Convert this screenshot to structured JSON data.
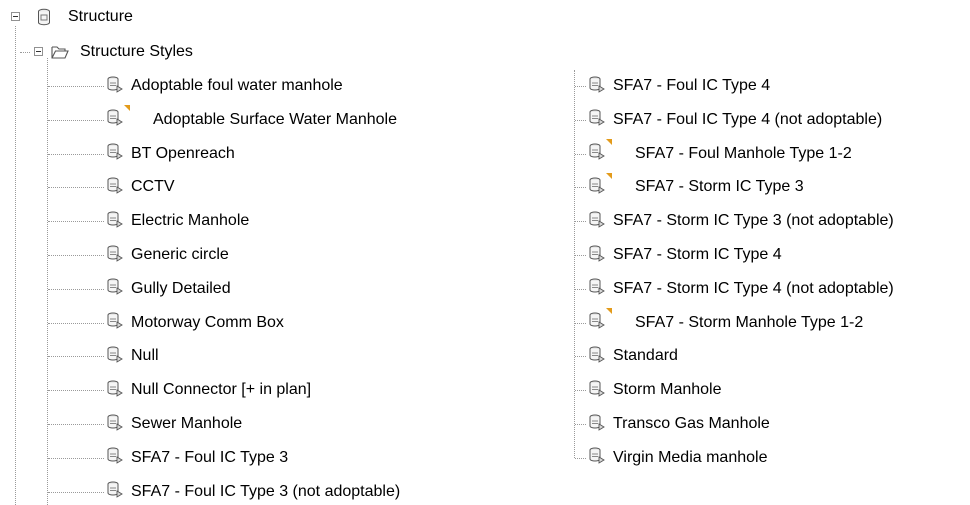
{
  "tree": {
    "root_label": "Structure",
    "styles_label": "Structure Styles",
    "left_items": [
      {
        "label": "Adoptable foul water manhole",
        "flag": false
      },
      {
        "label": "Adoptable Surface Water Manhole",
        "flag": true
      },
      {
        "label": "BT Openreach",
        "flag": false
      },
      {
        "label": "CCTV",
        "flag": false
      },
      {
        "label": "Electric Manhole",
        "flag": false
      },
      {
        "label": "Generic circle",
        "flag": false
      },
      {
        "label": "Gully Detailed",
        "flag": false
      },
      {
        "label": "Motorway Comm Box",
        "flag": false
      },
      {
        "label": "Null",
        "flag": false
      },
      {
        "label": "Null Connector [+ in plan]",
        "flag": false
      },
      {
        "label": "Sewer Manhole",
        "flag": false
      },
      {
        "label": "SFA7  - Foul IC Type 3",
        "flag": false
      },
      {
        "label": "SFA7  - Foul IC Type 3 (not adoptable)",
        "flag": false
      }
    ],
    "right_items": [
      {
        "label": "SFA7  - Foul IC Type 4",
        "flag": false
      },
      {
        "label": "SFA7  - Foul IC Type 4 (not adoptable)",
        "flag": false
      },
      {
        "label": "SFA7  - Foul Manhole Type 1-2",
        "flag": true
      },
      {
        "label": "SFA7  - Storm IC Type 3",
        "flag": true
      },
      {
        "label": "SFA7  - Storm IC Type 3 (not adoptable)",
        "flag": false
      },
      {
        "label": "SFA7  - Storm IC Type 4",
        "flag": false
      },
      {
        "label": "SFA7  - Storm IC Type 4 (not adoptable)",
        "flag": false
      },
      {
        "label": "SFA7  - Storm Manhole Type 1-2",
        "flag": true
      },
      {
        "label": "Standard",
        "flag": false
      },
      {
        "label": "Storm Manhole",
        "flag": false
      },
      {
        "label": "Transco Gas Manhole",
        "flag": false
      },
      {
        "label": "Virgin Media manhole",
        "flag": false
      }
    ]
  }
}
